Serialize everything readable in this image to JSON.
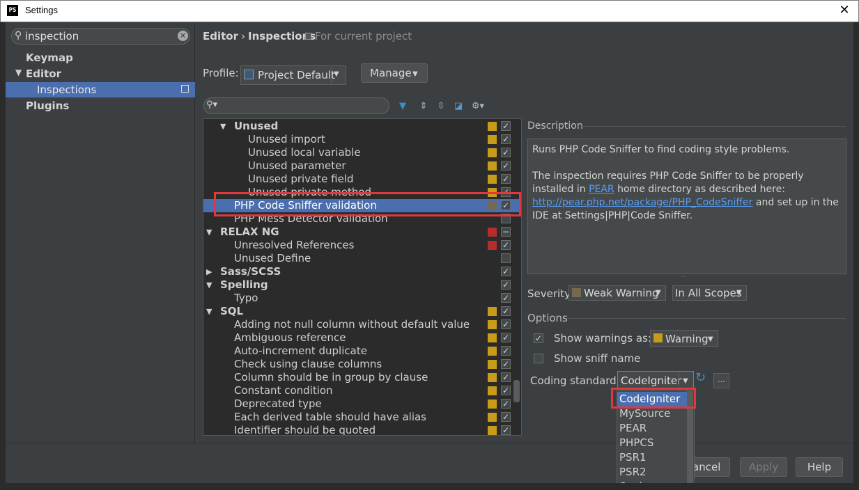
{
  "window": {
    "title": "Settings",
    "close_glyph": "✕",
    "logo": "PS"
  },
  "sidebar": {
    "search_value": "inspection",
    "clear_glyph": "✕",
    "items": [
      {
        "label": "Keymap"
      },
      {
        "label": "Editor"
      },
      {
        "label": "Inspections"
      },
      {
        "label": "Plugins"
      }
    ]
  },
  "header": {
    "crumb_parent": "Editor",
    "crumb_sep": "›",
    "crumb_current": "Inspections",
    "scope_note": "For current project"
  },
  "profile": {
    "label": "Profile:",
    "value": "Project Default",
    "manage_label": "Manage"
  },
  "tree": {
    "rows": [
      {
        "label": "Unused",
        "level": 1,
        "arrow": "▼",
        "group": true,
        "sev": "#c99b1a",
        "check": "✓"
      },
      {
        "label": "Unused import",
        "level": 2,
        "sev": "#c99b1a",
        "check": "✓"
      },
      {
        "label": "Unused local variable",
        "level": 2,
        "sev": "#c99b1a",
        "check": "✓"
      },
      {
        "label": "Unused parameter",
        "level": 2,
        "sev": "#c99b1a",
        "check": "✓"
      },
      {
        "label": "Unused private field",
        "level": 2,
        "sev": "#c99b1a",
        "check": "✓"
      },
      {
        "label": "Unused private method",
        "level": 2,
        "sev": "#c99b1a",
        "check": "✓"
      },
      {
        "label": "PHP Code Sniffer validation",
        "level": 1,
        "selected": true,
        "sev": "#756a50",
        "check": "✓"
      },
      {
        "label": "PHP Mess Detector validation",
        "level": 1,
        "sev": "",
        "check": ""
      },
      {
        "label": "RELAX NG",
        "level": 0,
        "arrow": "▼",
        "group": true,
        "sev": "#b52d2d",
        "check": "−"
      },
      {
        "label": "Unresolved References",
        "level": 1,
        "sev": "#b52d2d",
        "check": "✓"
      },
      {
        "label": "Unused Define",
        "level": 1,
        "sev": "",
        "check": ""
      },
      {
        "label": "Sass/SCSS",
        "level": 0,
        "arrow": "▶",
        "group": true,
        "sev": "",
        "check": "✓"
      },
      {
        "label": "Spelling",
        "level": 0,
        "arrow": "▼",
        "group": true,
        "sev": "",
        "check": "✓"
      },
      {
        "label": "Typo",
        "level": 1,
        "sev": "",
        "check": "✓"
      },
      {
        "label": "SQL",
        "level": 0,
        "arrow": "▼",
        "group": true,
        "sev": "#c99b1a",
        "check": "✓"
      },
      {
        "label": "Adding not null column without default value",
        "level": 1,
        "sev": "#c99b1a",
        "check": "✓"
      },
      {
        "label": "Ambiguous reference",
        "level": 1,
        "sev": "#c99b1a",
        "check": "✓"
      },
      {
        "label": "Auto-increment duplicate",
        "level": 1,
        "sev": "#c99b1a",
        "check": "✓"
      },
      {
        "label": "Check using clause columns",
        "level": 1,
        "sev": "#c99b1a",
        "check": "✓"
      },
      {
        "label": "Column should be in group by clause",
        "level": 1,
        "sev": "#c99b1a",
        "check": "✓"
      },
      {
        "label": "Constant condition",
        "level": 1,
        "sev": "#c99b1a",
        "check": "✓"
      },
      {
        "label": "Deprecated type",
        "level": 1,
        "sev": "#c99b1a",
        "check": "✓"
      },
      {
        "label": "Each derived table should have alias",
        "level": 1,
        "sev": "#c99b1a",
        "check": "✓"
      },
      {
        "label": "Identifier should be quoted",
        "level": 1,
        "sev": "#c99b1a",
        "check": "✓"
      }
    ]
  },
  "description": {
    "title": "Description",
    "p1": "Runs PHP Code Sniffer to find coding style problems.",
    "p2_a": "The inspection requires PHP Code Sniffer to be properly installed in ",
    "p2_link1": "PEAR",
    "p2_b": " home directory as described here: ",
    "p2_link2": "http://pear.php.net/package/PHP_CodeSniffer",
    "p2_c": " and set up in the IDE at Settings|PHP|Code Sniffer."
  },
  "severity": {
    "label": "Severity:",
    "value": "Weak Warning",
    "scope": "In All Scopes"
  },
  "options": {
    "title": "Options",
    "show_warnings_label": "Show warnings as:",
    "show_warnings_checked": "✓",
    "warnings_value": "Warning",
    "show_sniff_label": "Show sniff name",
    "coding_label": "Coding standard:",
    "coding_value": "CodeIgniter",
    "dots_label": "..."
  },
  "dropdown": {
    "options": [
      "CodeIgniter",
      "MySource",
      "PEAR",
      "PHPCS",
      "PSR1",
      "PSR2",
      "Squiz"
    ],
    "selected_index": 0
  },
  "buttons": {
    "cancel": "Cancel",
    "apply": "Apply",
    "help": "Help"
  }
}
